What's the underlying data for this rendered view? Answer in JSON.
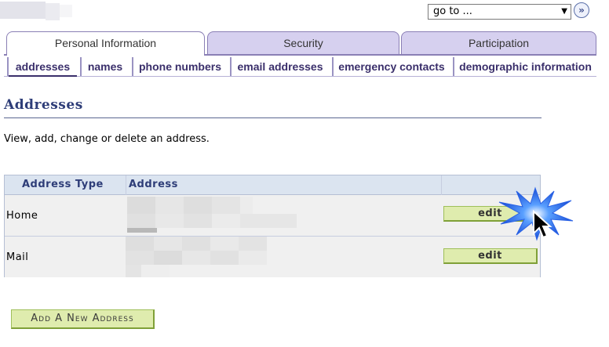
{
  "goto": {
    "value": "go to ...",
    "arrow": "▼",
    "button_glyph": "»"
  },
  "tabs": [
    {
      "label": "Personal Information",
      "active": true
    },
    {
      "label": "Security",
      "active": false
    },
    {
      "label": "Participation",
      "active": false
    }
  ],
  "subtabs": [
    {
      "label": "addresses",
      "active": true
    },
    {
      "label": "names"
    },
    {
      "label": "phone numbers"
    },
    {
      "label": "email addresses"
    },
    {
      "label": "emergency contacts"
    },
    {
      "label": "demographic information"
    }
  ],
  "page": {
    "title": "Addresses",
    "instructions": "View, add, change or delete an address."
  },
  "table": {
    "headers": {
      "type": "Address Type",
      "address": "Address",
      "action": ""
    },
    "rows": [
      {
        "type": "Home",
        "action": "edit"
      },
      {
        "type": "Mail",
        "action": "edit"
      }
    ]
  },
  "add_button": "Add A New Address",
  "colors": {
    "accent": "#2e3d78",
    "tab_bg": "#d6d0ef",
    "button_green": "#dfecae",
    "table_header": "#dbe4f0"
  }
}
